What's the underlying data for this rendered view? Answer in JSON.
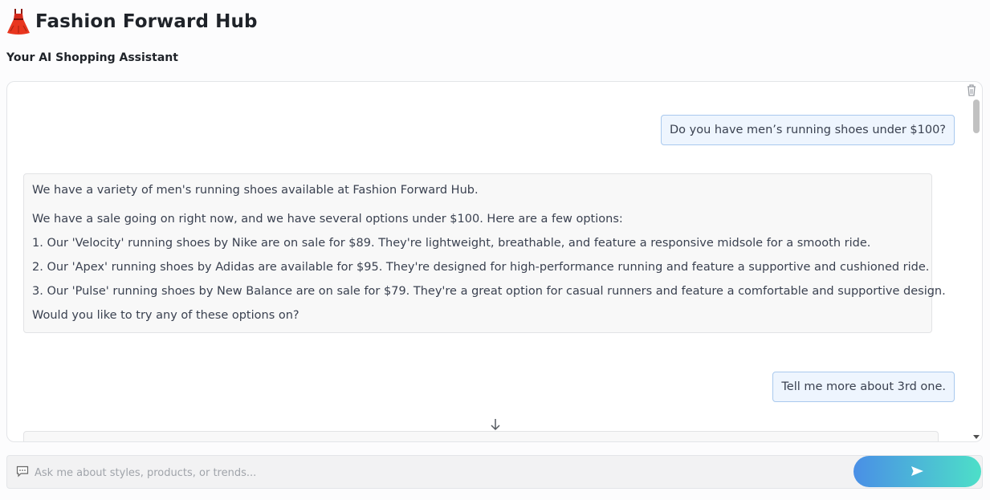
{
  "header": {
    "icon": "dress-icon",
    "title": "Fashion Forward Hub",
    "subtitle": "Your AI Shopping Assistant"
  },
  "chat": {
    "icons": {
      "clear": "trash-icon",
      "scroll_to_bottom": "down-arrow-icon"
    },
    "messages": [
      {
        "role": "user",
        "text": "Do you have men’s running shoes under $100?"
      },
      {
        "role": "assistant",
        "paragraphs": [
          "We have a variety of men's running shoes available at Fashion Forward Hub.",
          "We have a sale going on right now, and we have several options under $100. Here are a few options:"
        ],
        "list": [
          "1. Our 'Velocity' running shoes by Nike are on sale for $89. They're lightweight, breathable, and feature a responsive midsole for a smooth ride.",
          "2. Our 'Apex' running shoes by Adidas are available for $95. They're designed for high-performance running and feature a supportive and cushioned ride.",
          "3. Our 'Pulse' running shoes by New Balance are on sale for $79. They're a great option for casual runners and feature a comfortable and supportive design."
        ],
        "closing": "Would you like to try any of these options on?"
      },
      {
        "role": "user",
        "text": "Tell me more about 3rd one."
      }
    ]
  },
  "input": {
    "icon": "chat-bubble-icon",
    "placeholder": "Ask me about styles, products, or trends...",
    "value": "",
    "send_icon": "send-icon"
  },
  "colors": {
    "user_bubble_bg": "#eef5fe",
    "user_bubble_border": "#a9c9ee",
    "bot_bubble_bg": "#f8f8f8",
    "send_gradient_start": "#4a8fe6",
    "send_gradient_end": "#4ddfc8"
  }
}
